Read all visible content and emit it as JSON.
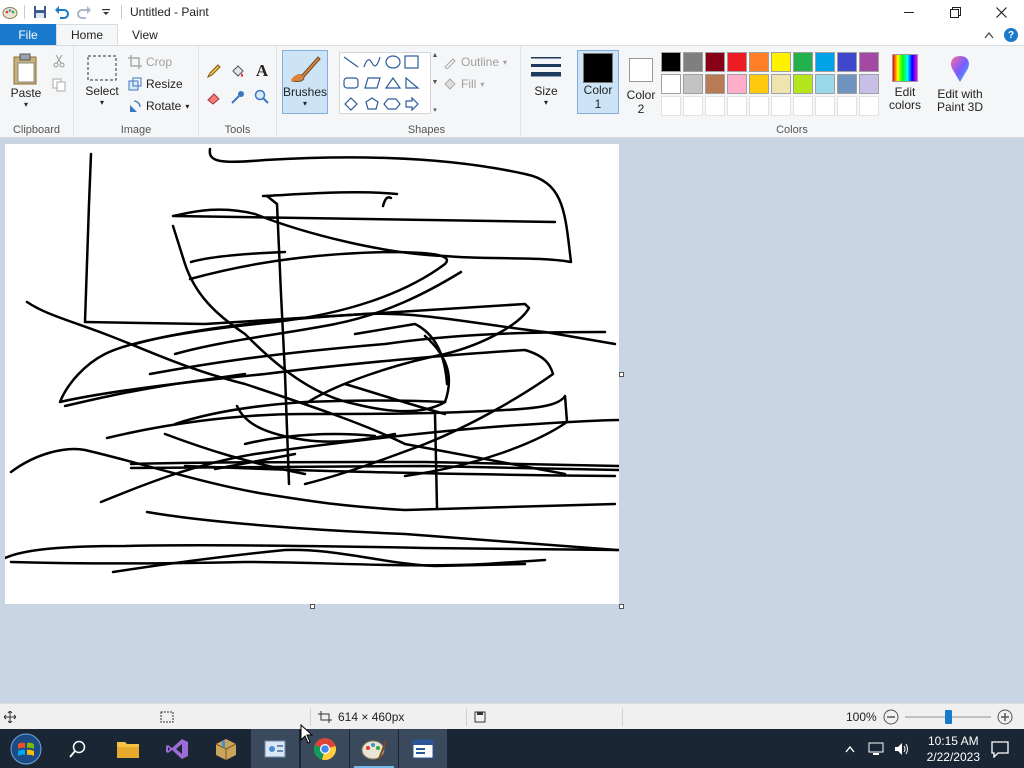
{
  "window": {
    "title": "Untitled - Paint",
    "minimize_icon": "minimize-icon",
    "maximize_icon": "restore-icon",
    "close_icon": "close-icon"
  },
  "tabs": {
    "file": "File",
    "home": "Home",
    "view": "View"
  },
  "ribbon": {
    "clipboard": {
      "label": "Clipboard",
      "paste": "Paste"
    },
    "image": {
      "label": "Image",
      "select": "Select",
      "crop": "Crop",
      "resize": "Resize",
      "rotate": "Rotate"
    },
    "tools": {
      "label": "Tools"
    },
    "brushes": {
      "label": "Brushes"
    },
    "shapes": {
      "label": "Shapes",
      "outline": "Outline",
      "fill": "Fill"
    },
    "size": {
      "label": "Size"
    },
    "color1": {
      "label": "Color",
      "num": "1",
      "value": "#000000"
    },
    "color2": {
      "label": "Color",
      "num": "2",
      "value": "#ffffff"
    },
    "colors": {
      "label": "Colors",
      "row1": [
        "#000000",
        "#7f7f7f",
        "#880015",
        "#ed1c24",
        "#ff7f27",
        "#fff200",
        "#22b14c",
        "#00a2e8",
        "#3f48cc",
        "#a349a4"
      ],
      "row2": [
        "#ffffff",
        "#c3c3c3",
        "#b97a57",
        "#ffaec9",
        "#ffc90e",
        "#efe4b0",
        "#b5e61d",
        "#99d9ea",
        "#7092be",
        "#c8bfe7"
      ]
    },
    "edit_colors": {
      "line1": "Edit",
      "line2": "colors"
    },
    "paint3d": {
      "line1": "Edit with",
      "line2": "Paint 3D"
    }
  },
  "status": {
    "dimensions": "614 × 460px",
    "zoom": "100%"
  },
  "taskbar": {
    "time": "10:15 AM",
    "date": "2/22/2023"
  }
}
